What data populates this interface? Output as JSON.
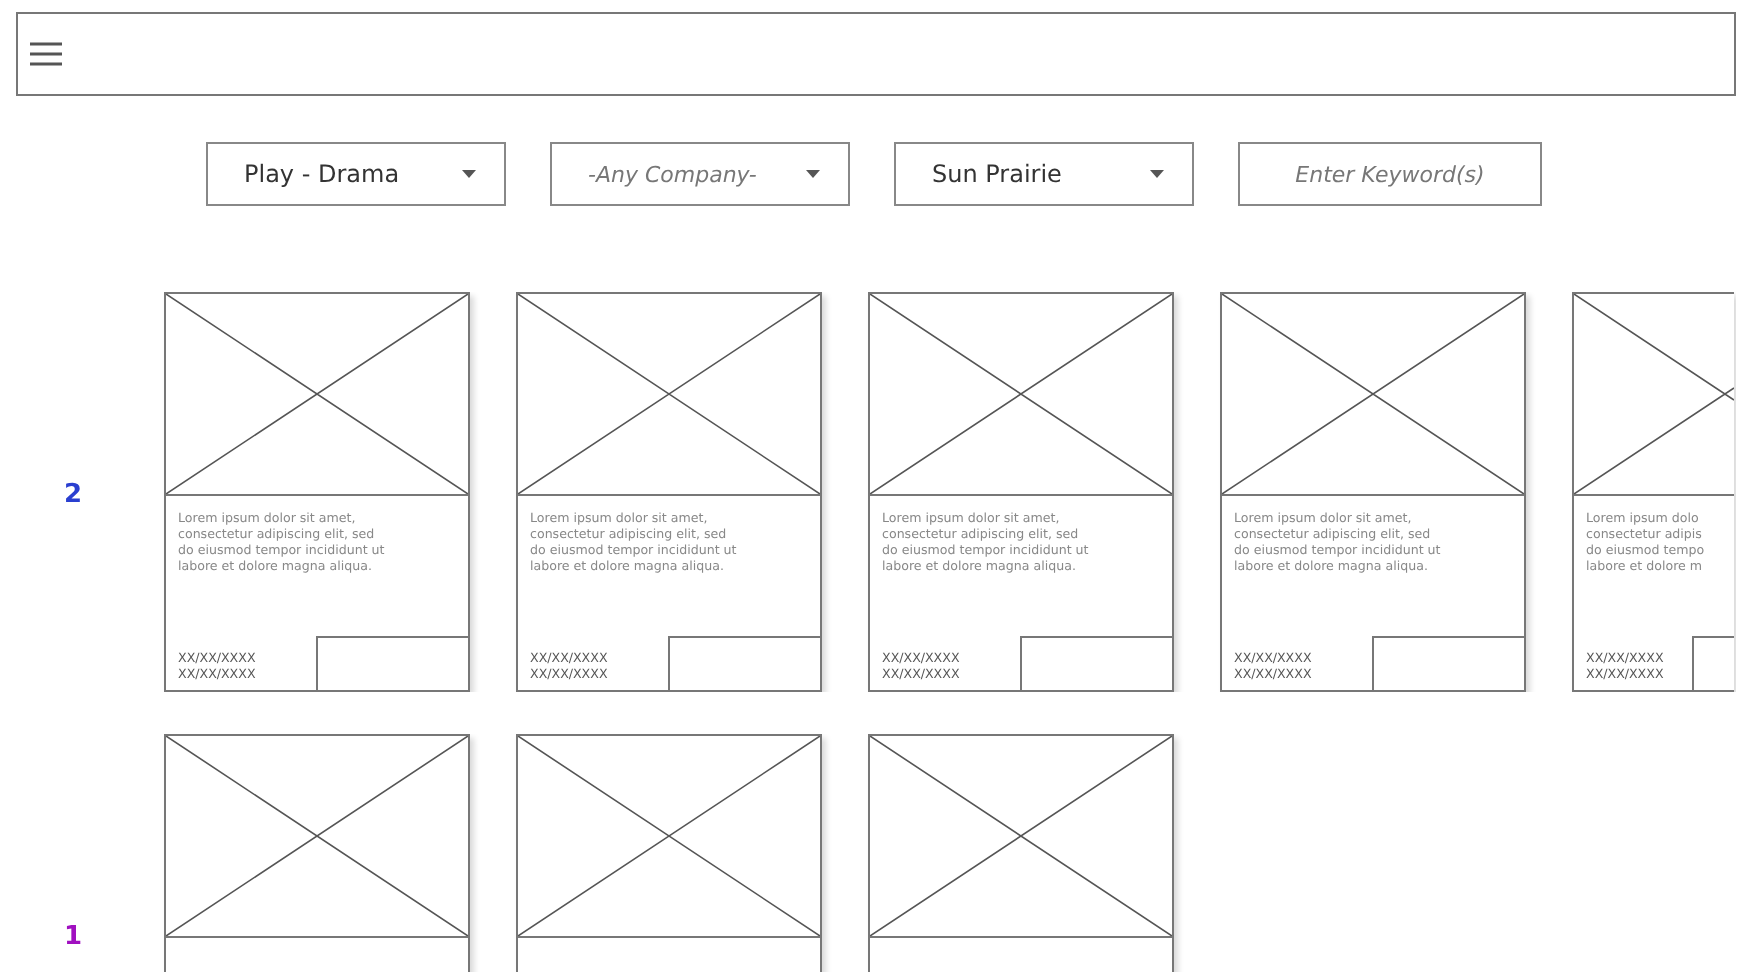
{
  "filters": [
    {
      "kind": "select",
      "value": "Play - Drama"
    },
    {
      "kind": "select",
      "placeholder": "-Any Company-"
    },
    {
      "kind": "select",
      "value": "Sun Prairie"
    },
    {
      "kind": "input",
      "placeholder": "Enter Keyword(s)"
    }
  ],
  "rows": [
    {
      "label": "2",
      "color": "#2a3fd0",
      "cards": [
        {
          "cut": false,
          "lines": [
            "Lorem ipsum dolor sit amet,",
            "consectetur adipiscing elit, sed",
            "do eiusmod tempor incididunt ut",
            "labore et dolore magna aliqua."
          ],
          "dates": [
            "XX/XX/XXXX",
            "XX/XX/XXXX"
          ]
        },
        {
          "cut": false,
          "lines": [
            "Lorem ipsum dolor sit amet,",
            "consectetur adipiscing elit, sed",
            "do eiusmod tempor incididunt ut",
            "labore et dolore magna aliqua."
          ],
          "dates": [
            "XX/XX/XXXX",
            "XX/XX/XXXX"
          ]
        },
        {
          "cut": false,
          "lines": [
            "Lorem ipsum dolor sit amet,",
            "consectetur adipiscing elit, sed",
            "do eiusmod tempor incididunt ut",
            "labore et dolore magna aliqua."
          ],
          "dates": [
            "XX/XX/XXXX",
            "XX/XX/XXXX"
          ]
        },
        {
          "cut": false,
          "lines": [
            "Lorem ipsum dolor sit amet,",
            "consectetur adipiscing elit, sed",
            "do eiusmod tempor incididunt ut",
            "labore et dolore magna aliqua."
          ],
          "dates": [
            "XX/XX/XXXX",
            "XX/XX/XXXX"
          ]
        },
        {
          "cut": true,
          "lines": [
            "Lorem ipsum dolo",
            "consectetur adipis",
            "do eiusmod tempo",
            "labore et dolore m"
          ],
          "dates": [
            "XX/XX/XXXX",
            "XX/XX/XXXX"
          ]
        }
      ]
    },
    {
      "label": "1",
      "color": "#a010c0",
      "cards": [
        {
          "cut": false
        },
        {
          "cut": false
        },
        {
          "cut": false
        }
      ]
    }
  ]
}
